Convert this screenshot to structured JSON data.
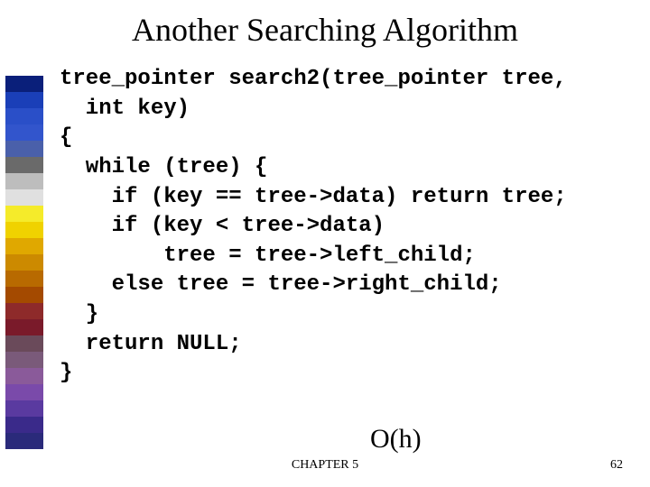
{
  "title": "Another Searching Algorithm",
  "code": {
    "l1": "tree_pointer search2(tree_pointer tree,",
    "l2": "  int key)",
    "l3": "{",
    "l4": "  while (tree) {",
    "l5": "    if (key == tree->data) return tree;",
    "l6": "    if (key < tree->data)",
    "l7": "        tree = tree->left_child;",
    "l8": "    else tree = tree->right_child;",
    "l9": "  }",
    "l10": "  return NULL;",
    "l11": "}"
  },
  "complexity": "O(h)",
  "footer": {
    "chapter": "CHAPTER 5",
    "page": "62"
  },
  "sidebar_colors": [
    "#0a1f7a",
    "#1a3fb8",
    "#2a4fc8",
    "#3255cc",
    "#4a60aa",
    "#6a6a6a",
    "#bdbdbd",
    "#e0e0e0",
    "#f5eb2a",
    "#f0d200",
    "#e0a800",
    "#cc8a00",
    "#b86a00",
    "#a44a00",
    "#8e2a2a",
    "#7a1a2a",
    "#6a4a5a",
    "#7a5a7a",
    "#8a5a9a",
    "#7a4aaa",
    "#5a3aa0",
    "#3a2a8a",
    "#2a2a7a"
  ]
}
